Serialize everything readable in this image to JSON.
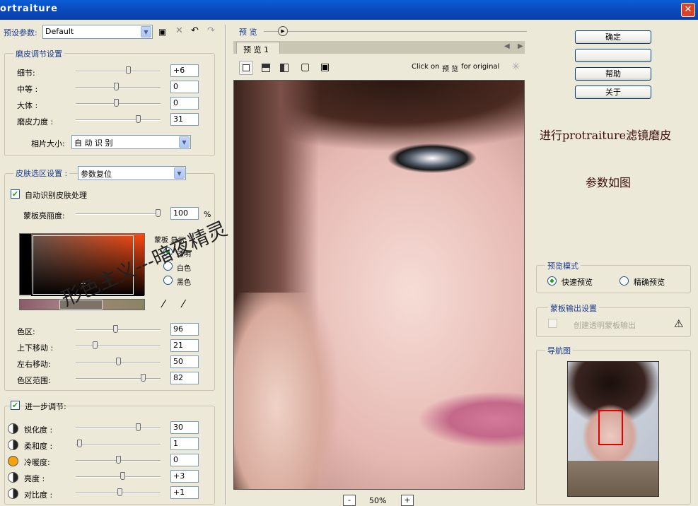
{
  "window": {
    "title": "ortraiture",
    "close": "✕"
  },
  "preset": {
    "label": "预设参数:",
    "value": "Default"
  },
  "smoothing": {
    "title": "磨皮调节设置",
    "rows": [
      {
        "label": "细节:",
        "value": "+6",
        "pos": 0.63
      },
      {
        "label": "中等 :",
        "value": "0",
        "pos": 0.48
      },
      {
        "label": "大体 :",
        "value": "0",
        "pos": 0.48
      },
      {
        "label": "磨皮力度 :",
        "value": "31",
        "pos": 0.75
      }
    ],
    "size_label": "相片大小:",
    "size_value": "自 动 识 别"
  },
  "skin": {
    "title": "皮肤选区设置 :",
    "preset_value": "参数复位",
    "auto_label": "自动识别皮肤处理",
    "mask_label": "蒙板亮丽度:",
    "mask_value": "100",
    "mask_unit": "%",
    "mask_pos": 0.98,
    "display_title": "蒙板 显示:",
    "display_opts": [
      "透明",
      "白色",
      "黑色"
    ],
    "rows": [
      {
        "label": "色区:",
        "value": "96",
        "pos": 0.47
      },
      {
        "label": "上下移动 :",
        "value": "21",
        "pos": 0.21
      },
      {
        "label": "左右移动:",
        "value": "50",
        "pos": 0.5
      },
      {
        "label": "色区范围:",
        "value": "82",
        "pos": 0.81
      }
    ]
  },
  "enhance": {
    "title": "进一步调节:",
    "rows": [
      {
        "label": "锐化度 :",
        "value": "30",
        "pos": 0.75,
        "icon": "sharpness-icon"
      },
      {
        "label": "柔和度 :",
        "value": "1",
        "pos": 0.02,
        "icon": "softness-icon"
      },
      {
        "label": "冷暖度:",
        "value": "0",
        "pos": 0.5,
        "icon": "warmth-icon"
      },
      {
        "label": "亮度 :",
        "value": "+3",
        "pos": 0.56,
        "icon": "brightness-icon"
      },
      {
        "label": "对比度 :",
        "value": "+1",
        "pos": 0.52,
        "icon": "contrast-icon"
      }
    ]
  },
  "preview": {
    "label": "预 览",
    "tab": "预 览  1",
    "hint_pre": "Click on",
    "hint_mid": "预 览",
    "hint_post": "for original",
    "zoom": "50%",
    "minus": "-",
    "plus": "+"
  },
  "buttons": {
    "ok": "确定",
    "blank": "",
    "help": "帮助",
    "about": "关于"
  },
  "note": {
    "line1": "进行protraiture滤镜磨皮",
    "line2": "参数如图"
  },
  "watermark": "形色主义---暗夜精灵",
  "preview_mode": {
    "title": "预览模式",
    "fast": "快速预览",
    "exact": "精确预览"
  },
  "mask_output": {
    "title": "蒙板输出设置",
    "label": "创建透明蒙板输出"
  },
  "navigator": {
    "title": "导航图"
  }
}
